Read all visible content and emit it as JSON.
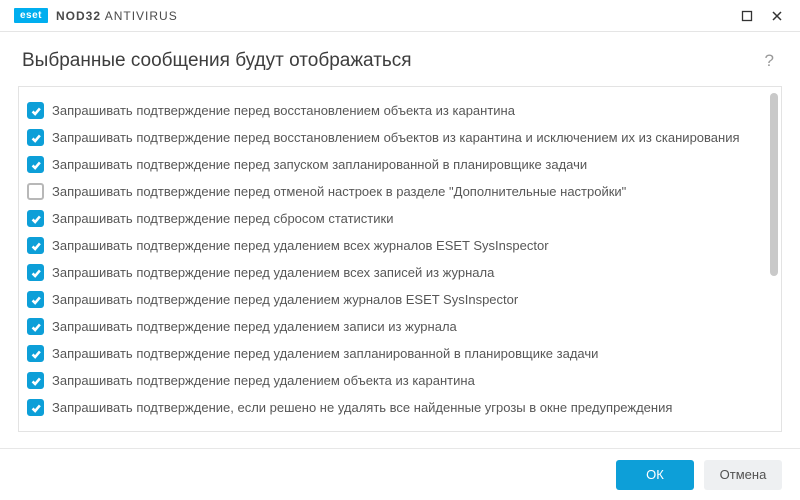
{
  "app": {
    "brand": "eset",
    "title_html": "NOD32 ANTIVIRUS",
    "title_bold": "NOD32",
    "title_rest": " ANTIVIRUS"
  },
  "header": {
    "title": "Выбранные сообщения будут отображаться"
  },
  "colors": {
    "accent": "#0d9fd8"
  },
  "items": [
    {
      "checked": true,
      "label": "Запрашивать подтверждение перед восстановлением объекта из карантина"
    },
    {
      "checked": true,
      "label": "Запрашивать подтверждение перед восстановлением объектов из карантина и исключением их из сканирования"
    },
    {
      "checked": true,
      "label": "Запрашивать подтверждение перед запуском запланированной в планировщике задачи"
    },
    {
      "checked": false,
      "label": "Запрашивать подтверждение перед отменой настроек в разделе \"Дополнительные настройки\""
    },
    {
      "checked": true,
      "label": "Запрашивать подтверждение перед сбросом статистики"
    },
    {
      "checked": true,
      "label": "Запрашивать подтверждение перед удалением всех журналов ESET SysInspector"
    },
    {
      "checked": true,
      "label": "Запрашивать подтверждение перед удалением всех записей из журнала"
    },
    {
      "checked": true,
      "label": "Запрашивать подтверждение перед удалением журналов ESET SysInspector"
    },
    {
      "checked": true,
      "label": "Запрашивать подтверждение перед удалением записи из журнала"
    },
    {
      "checked": true,
      "label": "Запрашивать подтверждение перед удалением запланированной в планировщике задачи"
    },
    {
      "checked": true,
      "label": "Запрашивать подтверждение перед удалением объекта из карантина"
    },
    {
      "checked": true,
      "label": "Запрашивать подтверждение, если решено не удалять все найденные угрозы в окне предупреждения"
    }
  ],
  "footer": {
    "ok": "ОК",
    "cancel": "Отмена"
  }
}
